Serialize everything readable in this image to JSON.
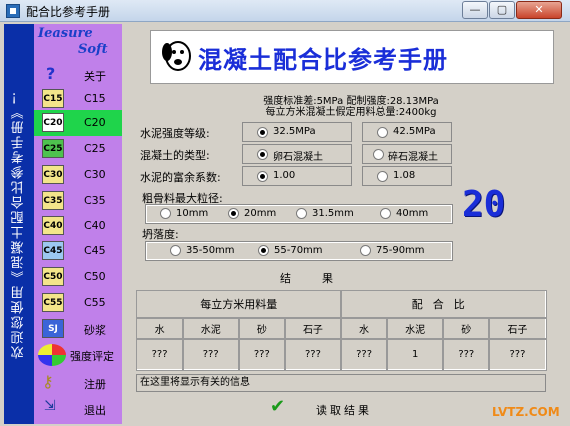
{
  "window": {
    "title": "配合比参考手册",
    "min": "—",
    "max": "▢",
    "close": "✕"
  },
  "welcome": "欢迎您使用《混凝土配合比参考手册》！",
  "logo": {
    "line1": "Ieasure",
    "line2": "Soft"
  },
  "sidebar": {
    "items": [
      {
        "icon": "?",
        "label": "关于"
      },
      {
        "icon": "C15",
        "label": "C15"
      },
      {
        "icon": "C20",
        "label": "C20",
        "active": true
      },
      {
        "icon": "C25",
        "label": "C25"
      },
      {
        "icon": "C30",
        "label": "C30"
      },
      {
        "icon": "C35",
        "label": "C35"
      },
      {
        "icon": "C40",
        "label": "C40"
      },
      {
        "icon": "C45",
        "label": "C45"
      },
      {
        "icon": "C50",
        "label": "C50"
      },
      {
        "icon": "C55",
        "label": "C55"
      },
      {
        "icon": "SJ",
        "label": "砂浆"
      },
      {
        "icon": "",
        "label": "强度评定"
      },
      {
        "icon": "",
        "label": "注册"
      },
      {
        "icon": "",
        "label": "退出"
      }
    ]
  },
  "heading": "混凝土配合比参考手册",
  "info": {
    "line1": "强度标准差:5MPa 配制强度:28.13MPa",
    "line2": "每立方米混凝土假定用料总量:2400kg"
  },
  "form": {
    "cement_grade": {
      "label": "水泥强度等级:",
      "options": [
        "32.5MPa",
        "42.5MPa"
      ],
      "selected": 0
    },
    "concrete_type": {
      "label": "混凝土的类型:",
      "options": [
        "卵石混凝土",
        "碎石混凝土"
      ],
      "selected": 0
    },
    "cement_factor": {
      "label": "水泥的富余系数:",
      "options": [
        "1.00",
        "1.08"
      ],
      "selected": 0
    },
    "aggregate": {
      "label": "粗骨料最大粒径:",
      "options": [
        "10mm",
        "20mm",
        "31.5mm",
        "40mm"
      ],
      "selected": 1
    },
    "slump": {
      "label": "坍落度:",
      "options": [
        "35-50mm",
        "55-70mm",
        "75-90mm"
      ],
      "selected": 1
    }
  },
  "grade_display": "20",
  "results": {
    "title": "结　果",
    "group1": "每立方米用料量",
    "group2": "配合比",
    "headers": [
      "水",
      "水泥",
      "砂",
      "石子",
      "水",
      "水泥",
      "砂",
      "石子"
    ],
    "values": [
      "???",
      "???",
      "???",
      "???",
      "???",
      "1",
      "???",
      "???"
    ]
  },
  "message": "在这里将显示有关的信息",
  "read_button": "读取结果",
  "watermark": "LVTZ.COM"
}
